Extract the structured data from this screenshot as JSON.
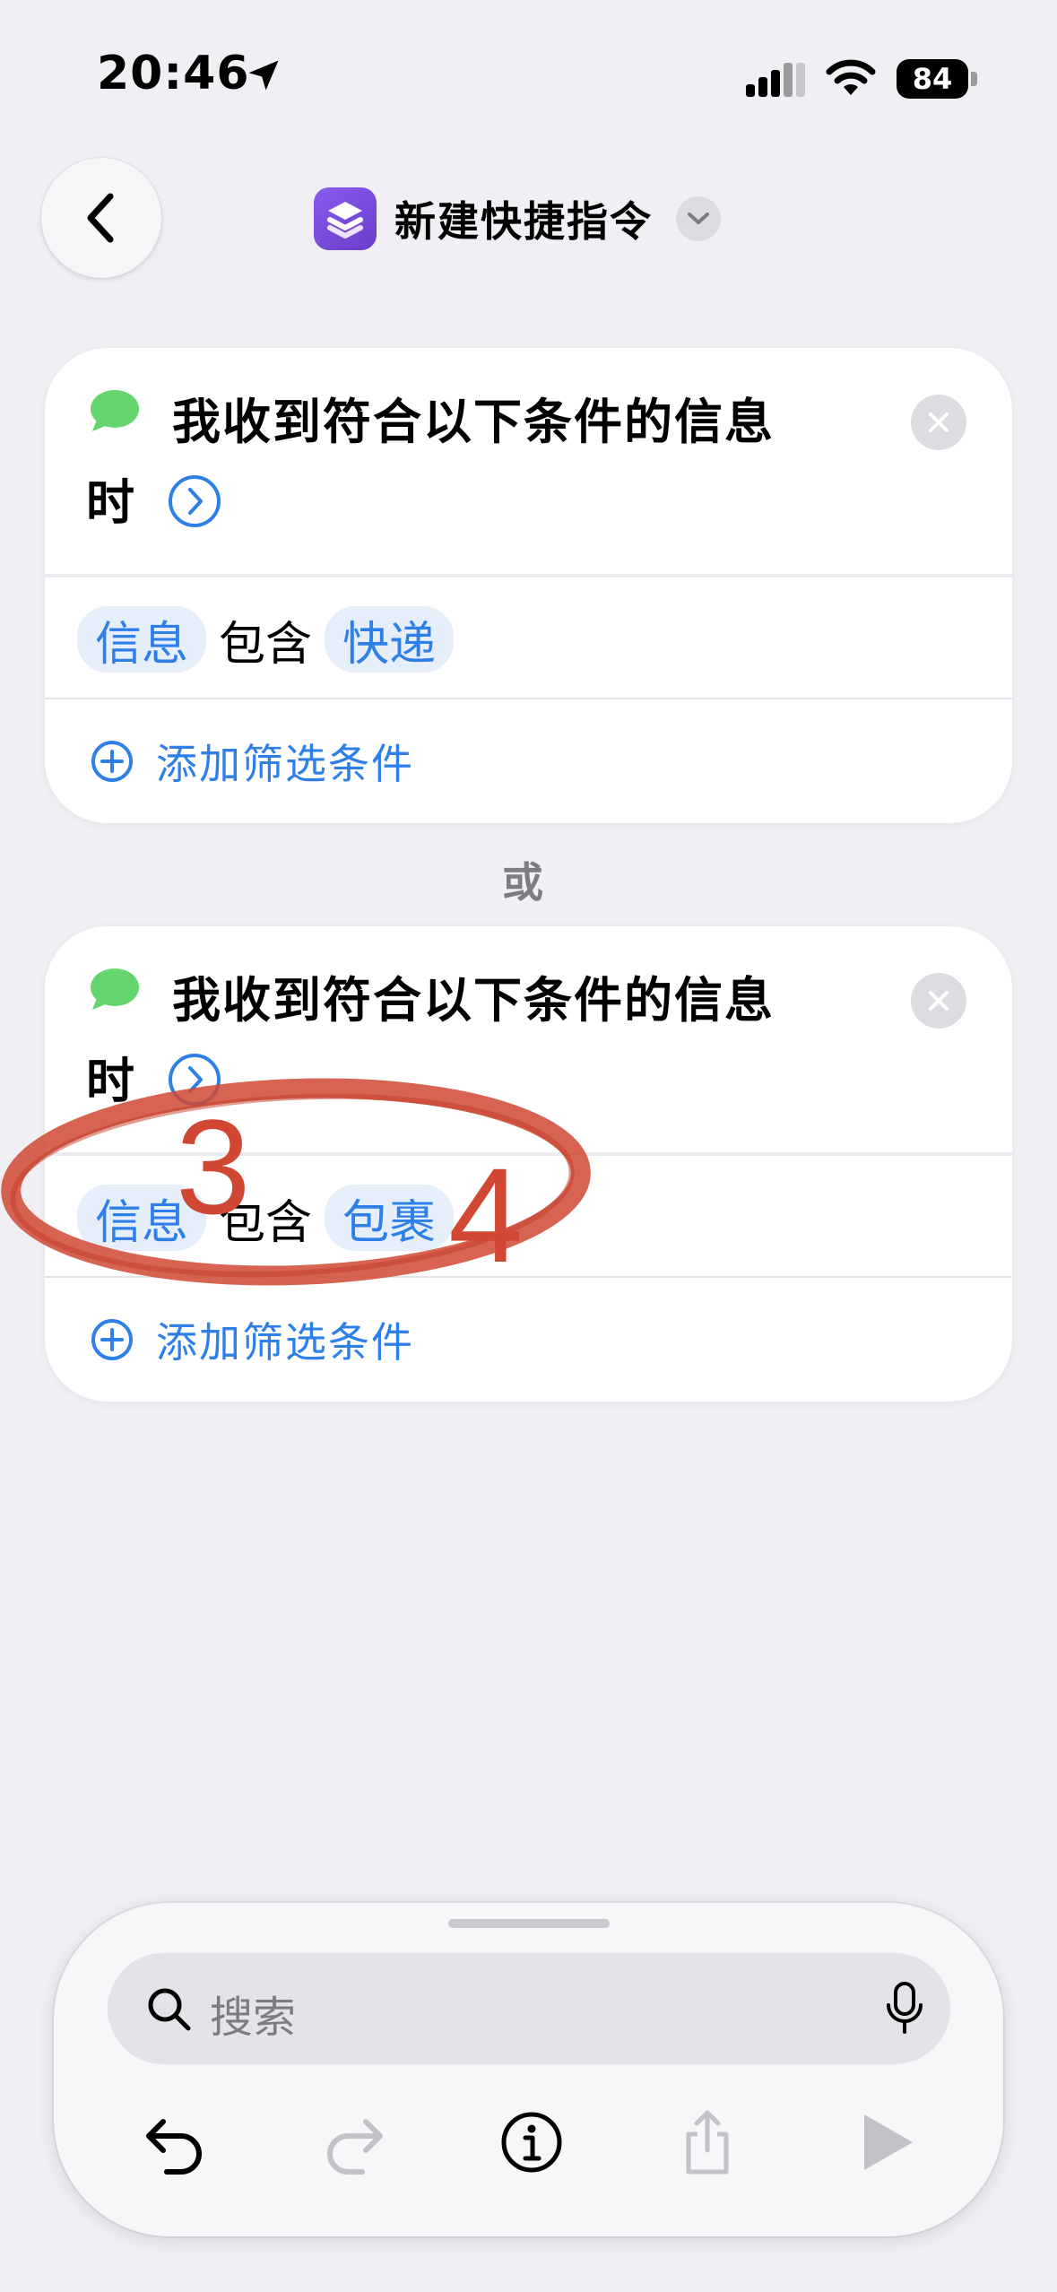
{
  "status_bar": {
    "time": "20:46",
    "battery": "84"
  },
  "nav": {
    "title": "新建快捷指令"
  },
  "cards": [
    {
      "trigger_line1": "我收到符合以下条件的信息",
      "trigger_line2": "时",
      "filter": {
        "subject": "信息",
        "operator": "包含",
        "value": "快递"
      },
      "add_filter": "添加筛选条件"
    },
    {
      "trigger_line1": "我收到符合以下条件的信息",
      "trigger_line2": "时",
      "filter": {
        "subject": "信息",
        "operator": "包含",
        "value": "包裹"
      },
      "add_filter": "添加筛选条件"
    }
  ],
  "or_label": "或",
  "annotation": {
    "num1": "3",
    "num2": "4",
    "color": "#d04834"
  },
  "search": {
    "placeholder": "搜索"
  },
  "toolbar": {
    "items": [
      "undo-icon",
      "redo-icon",
      "info-icon",
      "share-icon",
      "play-icon"
    ]
  },
  "colors": {
    "accent": "#2e7fe8",
    "background": "#efeff4",
    "app_icon": "#7a4ee0",
    "message_green": "#65d56e"
  }
}
